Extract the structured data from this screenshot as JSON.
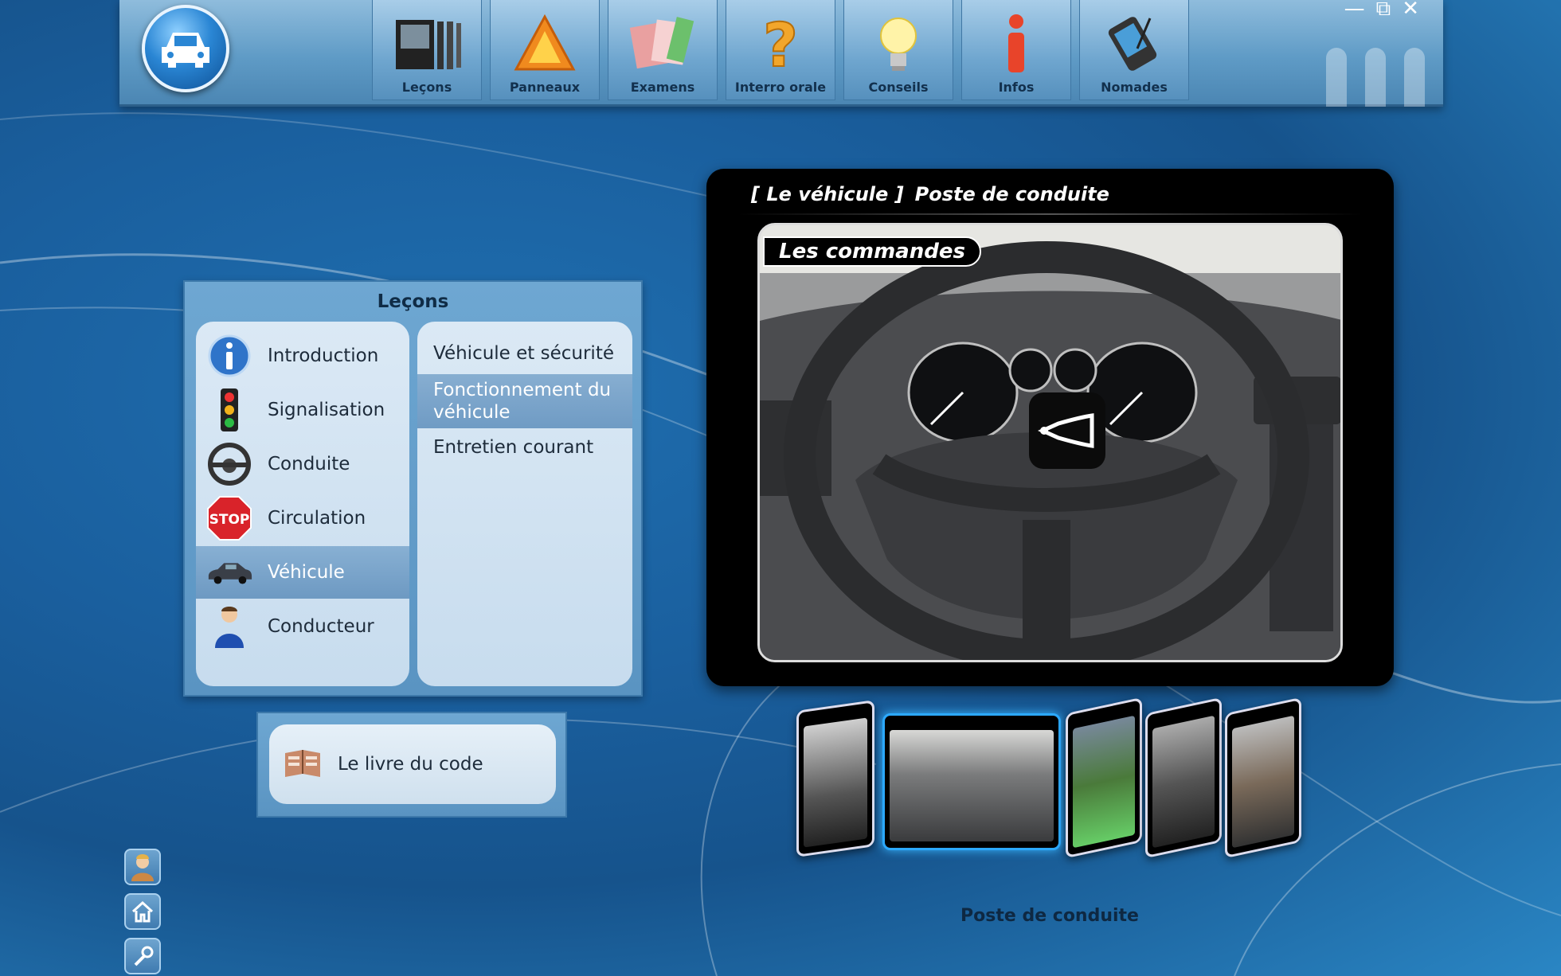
{
  "toolbar": {
    "items": [
      {
        "label": "Leçons",
        "icon": "lessons-icon"
      },
      {
        "label": "Panneaux",
        "icon": "warning-sign-icon"
      },
      {
        "label": "Examens",
        "icon": "exam-cards-icon"
      },
      {
        "label": "Interro orale",
        "icon": "question-mark-icon"
      },
      {
        "label": "Conseils",
        "icon": "lightbulb-icon"
      },
      {
        "label": "Infos",
        "icon": "info-icon"
      },
      {
        "label": "Nomades",
        "icon": "pda-icon"
      }
    ],
    "window_controls": {
      "minimize": "—",
      "restore": "⧉",
      "close": "✕"
    }
  },
  "lessons": {
    "title": "Leçons",
    "categories": [
      {
        "label": "Introduction",
        "icon": "info-icon"
      },
      {
        "label": "Signalisation",
        "icon": "traffic-light-icon"
      },
      {
        "label": "Conduite",
        "icon": "steering-wheel-icon"
      },
      {
        "label": "Circulation",
        "icon": "stop-sign-icon"
      },
      {
        "label": "Véhicule",
        "icon": "car-icon",
        "selected": true
      },
      {
        "label": "Conducteur",
        "icon": "driver-icon"
      }
    ],
    "subcategories": [
      {
        "label": "Véhicule et sécurité"
      },
      {
        "label": "Fonctionnement du véhicule",
        "selected": true
      },
      {
        "label": "Entretien courant"
      }
    ],
    "stop_text": "STOP"
  },
  "book": {
    "label": "Le livre du code",
    "icon": "book-icon"
  },
  "side_icons": [
    "user-avatar-icon",
    "home-icon",
    "settings-icon"
  ],
  "viewer": {
    "section": "[ Le véhicule ]",
    "title": "Poste de conduite",
    "badge": "Les commandes",
    "overlay_icon": "horn-icon"
  },
  "carousel": {
    "caption": "Poste de conduite",
    "active_index": 1,
    "count": 5
  },
  "colors": {
    "accent": "#2a86d4",
    "selected": "#6d99c2",
    "background": "#1a5f9e"
  }
}
